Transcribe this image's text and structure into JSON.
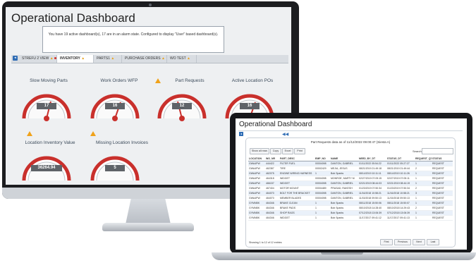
{
  "monitor": {
    "title": "Operational Dashboard",
    "alert_text": "You have 19 active dashboard(s), 17 are in an alarm state.  Configured to display \"User\" based dashboard(s).",
    "tabs": [
      {
        "label": "STREFU 2 VIEW",
        "warn": true,
        "alarm": true
      },
      {
        "label": "INVENTORY",
        "warn": true,
        "alarm": false
      },
      {
        "label": "PARTS1",
        "warn": true,
        "alarm": false
      },
      {
        "label": "PURCHASE ORDERS",
        "warn": true,
        "alarm": false
      },
      {
        "label": "WO TEST",
        "warn": true,
        "alarm": false
      }
    ],
    "panels": [
      {
        "label": "Slow Moving Parts",
        "value": "17",
        "warn": false
      },
      {
        "label": "Work Orders WFP",
        "value": "16",
        "warn": false
      },
      {
        "label": "Part Requests",
        "value": "12",
        "warn": true
      },
      {
        "label": "Active Location POs",
        "value": "16",
        "warn": false
      },
      {
        "label": "Location Inventory Value",
        "value": "36264.94",
        "warn": true
      },
      {
        "label": "Missing Location Invoices",
        "value": "5",
        "warn": true
      }
    ]
  },
  "laptop": {
    "title": "Operational Dashboard",
    "collapse_icon": "double-chevron-left-icon",
    "card_title": "Part Requests data as of 11/12/2022 09:00:47 (Siesta A)",
    "buttons": [
      "Show all rows",
      "Copy",
      "Excel",
      "Print"
    ],
    "search_label": "Search:",
    "columns": [
      "LOCATION",
      "WO_NR",
      "PART_DESC",
      "EMP_NO",
      "NAME",
      "NEED_BY_DT",
      "STATUS_DT",
      "REQUEST_QTY",
      "STATUS"
    ],
    "rows": [
      [
        "GWA4PW",
        "444422",
        "FILTER FUEL",
        "00004098",
        "DANTON, GABRIEL",
        "01/11/2022 05:54:22",
        "01/11/2022 05:27:27",
        "1",
        "REQUEST"
      ],
      [
        "GWA4PW",
        "462387",
        "TIRE",
        "00002429",
        "MEJIA, JESUS",
        "08/21/2019 21:49:18",
        "08/21/2019 21:49:44",
        "2",
        "REQUEST"
      ],
      [
        "GWA4PW",
        "462075",
        "ENGINE WIRING HARNESS",
        "1",
        "Bob Sparks",
        "08/14/2019 10:11:11",
        "08/14/2019 10:11:26",
        "1",
        "REQUEST"
      ],
      [
        "GWA4PW",
        "464318",
        "WIDGET",
        "00004098",
        "MONROE, MARTY M",
        "02/27/2019 07:09:15",
        "02/27/2019 07:05:11",
        "1",
        "REQUEST"
      ],
      [
        "GWA4PW",
        "466157",
        "WIDGET",
        "00004098",
        "DANTON, GABRIEL",
        "02/21/2019 08:44:03",
        "02/21/2019 08:44:19",
        "1",
        "REQUEST"
      ],
      [
        "GWA4PW",
        "467404",
        "MOTOR MOUNT",
        "00004489",
        "PRASAD, RAKESH",
        "01/23/2019 07:50:34",
        "01/23/2019 07:50:34",
        "2",
        "REQUEST"
      ],
      [
        "GWA4PW",
        "464070",
        "BOLT FOR THE BRACKET",
        "00004098",
        "DANTON, GABRIEL",
        "11/16/2018 10:58:21",
        "11/16/2018 10:58:21",
        "3",
        "REQUEST"
      ],
      [
        "GWA4PW",
        "464070",
        "MEMBER BLADES",
        "00004098",
        "DANTON, GABRIEL",
        "11/15/2018 09:50:13",
        "11/15/2018 09:50:13",
        "1",
        "REQUEST"
      ],
      [
        "GYMNBK",
        "464346",
        "BRAKE CLEAN",
        "1",
        "Bob Sparks",
        "08/11/2018 15:50:06",
        "08/11/2018 15:50:07",
        "1",
        "REQUEST"
      ],
      [
        "GYMNBK",
        "464346",
        "BRAKE PADS",
        "1",
        "Bob Sparks",
        "08/10/2018 14:28:40",
        "08/10/2018 14:29:43",
        "2",
        "REQUEST"
      ],
      [
        "GYMNBK",
        "464346",
        "SHOP RAGS",
        "1",
        "Bob Sparks",
        "07/12/2018 13:06:39",
        "07/12/2018 13:06:39",
        "1",
        "REQUEST"
      ],
      [
        "GYMNBK",
        "464346",
        "WIDGET",
        "1",
        "Bob Sparks",
        "11/17/2017 09:41:12",
        "11/17/2017 09:41:13",
        "1",
        "REQUEST"
      ]
    ],
    "showing": "Showing 1 to 12 of 12 entries",
    "pager": [
      "First",
      "Previous",
      "Next",
      "Last"
    ]
  }
}
